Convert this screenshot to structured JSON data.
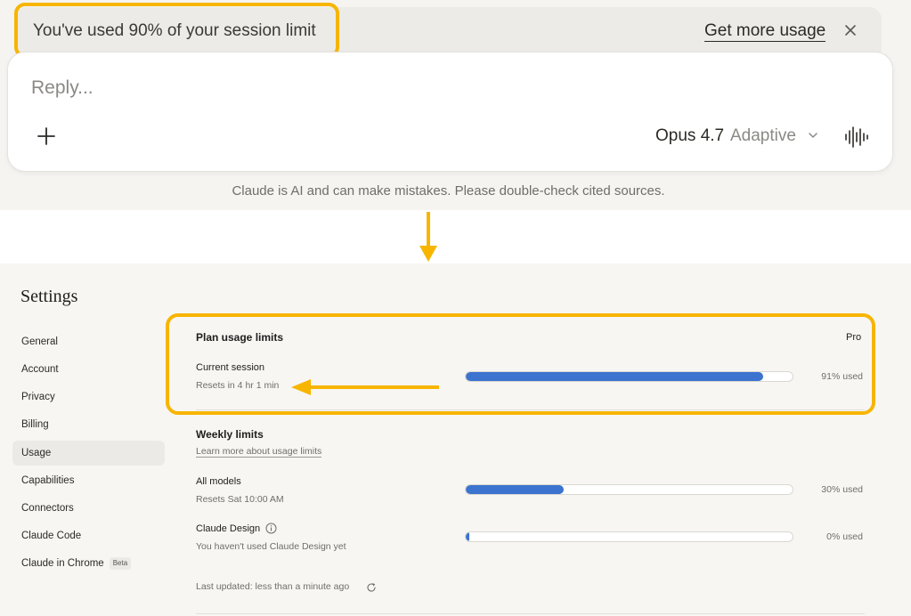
{
  "banner": {
    "usage_text": "You've used 90% of your session limit",
    "get_more_label": "Get more usage"
  },
  "composer": {
    "placeholder": "Reply...",
    "model_name": "Opus 4.7",
    "model_mode": "Adaptive"
  },
  "disclaimer": "Claude is AI and can make mistakes. Please double-check cited sources.",
  "settings": {
    "title": "Settings",
    "nav": [
      {
        "label": "General"
      },
      {
        "label": "Account"
      },
      {
        "label": "Privacy"
      },
      {
        "label": "Billing"
      },
      {
        "label": "Usage",
        "active": true
      },
      {
        "label": "Capabilities"
      },
      {
        "label": "Connectors"
      },
      {
        "label": "Claude Code"
      },
      {
        "label": "Claude in Chrome",
        "badge": "Beta"
      }
    ],
    "plan": {
      "title": "Plan usage limits",
      "tier": "Pro",
      "current_session": {
        "label": "Current session",
        "reset": "Resets in 4 hr 1 min",
        "percent": 91,
        "used_text": "91% used"
      }
    },
    "weekly": {
      "title": "Weekly limits",
      "learn_more": "Learn more about usage limits",
      "all_models": {
        "label": "All models",
        "reset": "Resets Sat 10:00 AM",
        "percent": 30,
        "used_text": "30% used"
      },
      "claude_design": {
        "label": "Claude Design",
        "note": "You haven't used Claude Design yet",
        "percent": 0,
        "used_text": "0% used"
      }
    },
    "last_updated": "Last updated: less than a minute ago"
  },
  "colors": {
    "highlight": "#f7b500",
    "bar_fill": "#3b73cf"
  },
  "icons": [
    "close-icon",
    "plus-icon",
    "chevron-down-icon",
    "voice-waveform-icon",
    "arrow-down-icon",
    "info-icon",
    "refresh-icon",
    "arrow-left-icon"
  ]
}
